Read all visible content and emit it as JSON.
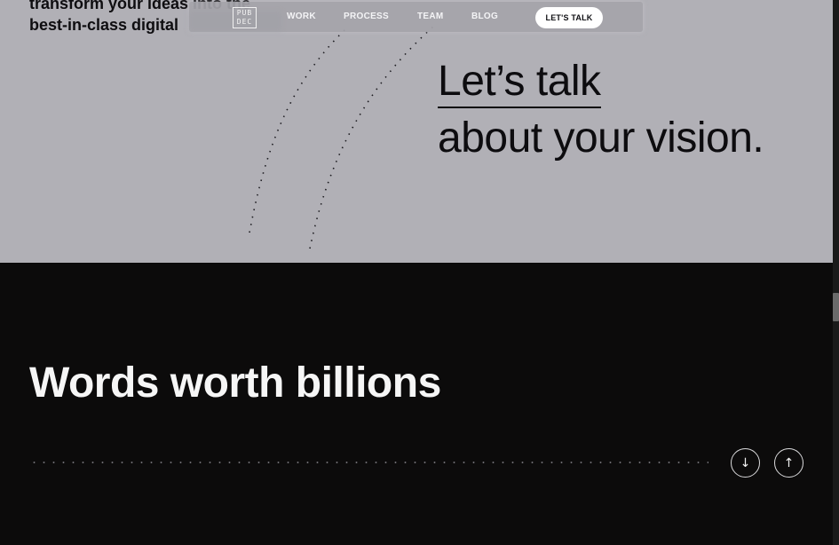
{
  "hero": {
    "text_line1": "transform your ideas into the",
    "text_line2": "best-in-class digital"
  },
  "nav": {
    "logo_line1": "PUB",
    "logo_line2": "DEC",
    "links": [
      {
        "label": "WORK"
      },
      {
        "label": "PROCESS"
      },
      {
        "label": "TEAM"
      },
      {
        "label": "BLOG"
      }
    ],
    "cta_label": "LET'S TALK"
  },
  "cta": {
    "line1": "Let’s talk",
    "line2": "about your vision."
  },
  "section": {
    "title": "Words worth billions"
  },
  "controls": {
    "down_icon": "arrow-down-icon",
    "up_icon": "arrow-up-icon"
  },
  "colors": {
    "hero_bg": "#b1b0b6",
    "dark_bg": "#0c0b0b",
    "text_dark": "#0d0c0f",
    "text_light": "#f6f6f6"
  }
}
